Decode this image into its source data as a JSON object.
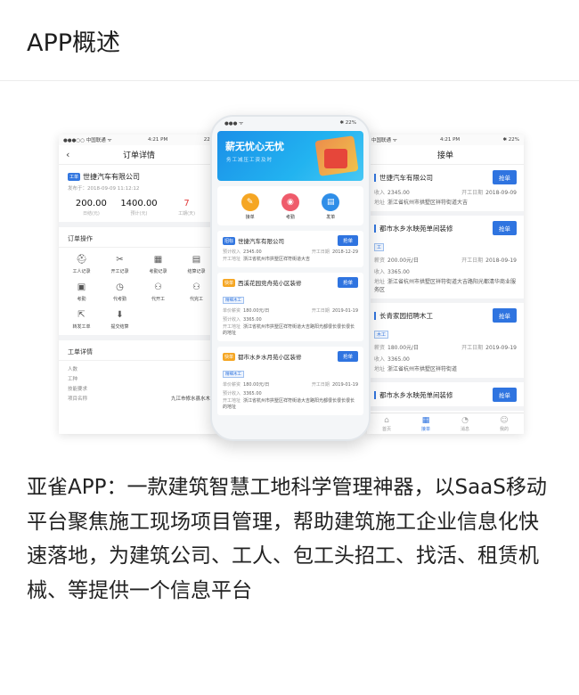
{
  "page_title": "APP概述",
  "description": "亚雀APP：一款建筑智慧工地科学管理神器，以SaaS移动平台聚焦施工现场项目管理，帮助建筑施工企业信息化快速落地，为建筑公司、工人、包工头招工、找活、租赁机械、等提供一个信息平台",
  "left_screen": {
    "status": {
      "carrier": "●●●○○ 中国联通 ᯤ",
      "time": "4:21 PM",
      "battery": "22%"
    },
    "title": "订单详情",
    "back": "‹",
    "order": {
      "tag": "工单",
      "company": "世捷汽车有限公司",
      "published": "发布于：2018-09-09  11:12:12",
      "stats": [
        {
          "num": "200.00",
          "label": "日结(元)"
        },
        {
          "num": "1400.00",
          "label": "预计(元)"
        },
        {
          "num": "7",
          "label": "工期(天)"
        }
      ]
    },
    "ops_title": "订单操作",
    "ops": [
      {
        "icon": "worker-icon",
        "glyph": "⛑",
        "label": "工人记录"
      },
      {
        "icon": "tools-icon",
        "glyph": "✂",
        "label": "开工记录"
      },
      {
        "icon": "calendar-icon",
        "glyph": "▦",
        "label": "考勤记录"
      },
      {
        "icon": "settle-icon",
        "glyph": "▤",
        "label": "结算记录"
      },
      {
        "icon": "checkin-icon",
        "glyph": "▣",
        "label": "考勤"
      },
      {
        "icon": "proxy-checkin-icon",
        "glyph": "◷",
        "label": "代考勤"
      },
      {
        "icon": "proxy-start-icon",
        "glyph": "⚇",
        "label": "代开工"
      },
      {
        "icon": "proxy-icon",
        "glyph": "⚇",
        "label": "代完工"
      },
      {
        "icon": "transfer-icon",
        "glyph": "⇱",
        "label": "转发工单"
      },
      {
        "icon": "submit-icon",
        "glyph": "⬇",
        "label": "提交结算"
      }
    ],
    "detail_title": "工单详情",
    "details": [
      {
        "k": "人数",
        "v": ""
      },
      {
        "k": "工种",
        "v": ""
      },
      {
        "k": "技能要求",
        "v": ""
      },
      {
        "k": "项目名称",
        "v": "九江市修水县水木"
      }
    ]
  },
  "center_phone": {
    "status": {
      "left": "●●●  ᯤ",
      "right": "✱ 22%"
    },
    "banner_title": "薪无忧心无忧",
    "banner_sub": "务工减压工资及时",
    "quick": [
      {
        "icon": "grab-order-icon",
        "glyph": "✎",
        "label": "接单",
        "color": "#f5a623"
      },
      {
        "icon": "attendance-icon",
        "glyph": "◉",
        "label": "考勤",
        "color": "#ef5b6b"
      },
      {
        "icon": "post-order-icon",
        "glyph": "▤",
        "label": "发单",
        "color": "#2f8ee8"
      }
    ],
    "cards": [
      {
        "tag": "招标",
        "tag_color": "blue",
        "title": "世捷汽车有限公司",
        "grab": "抢单",
        "row1_k": "预计收入",
        "row1_v": "2345.00",
        "row1_dk": "开工日期",
        "row1_dv": "2018-12-29",
        "row2_k": "",
        "row2_v": "",
        "addr_k": "开工地址",
        "addr_v": "浙江省杭州市拱墅区祥符街道大吉",
        "subtag": ""
      },
      {
        "tag": "快单",
        "tag_color": "orange",
        "title": "西溪花园竞舟苑小区装修",
        "grab": "抢单",
        "subtag": "精细木工",
        "row1_k": "单价薪资",
        "row1_v": "180.00元/日",
        "row1_dk": "开工日期",
        "row1_dv": "2019-01-19",
        "row2_k": "预计收入",
        "row2_v": "3365.00",
        "addr_k": "开工地址",
        "addr_v": "浙江省杭州市拱墅区祥符街道大吉路阳光都很长很长很长的地址"
      },
      {
        "tag": "快单",
        "tag_color": "orange",
        "title": "都市水乡水月苑小区装修",
        "grab": "抢单",
        "subtag": "精细木工",
        "row1_k": "单价薪资",
        "row1_v": "180.00元/日",
        "row1_dk": "开工日期",
        "row1_dv": "2019-01-19",
        "row2_k": "预计收入",
        "row2_v": "3365.00",
        "addr_k": "开工地址",
        "addr_v": "浙江省杭州市拱墅区祥符街道大吉路阳光都很长很长很长的地址"
      }
    ]
  },
  "right_screen": {
    "status": {
      "carrier": "中国联通 ᯤ",
      "time": "4:21 PM",
      "battery": "✱ 22%"
    },
    "title": "接单",
    "cards": [
      {
        "title": "世捷汽车有限公司",
        "grab": "抢单",
        "subtag": "",
        "row1_k": "收入",
        "row1_v": "2345.00",
        "row1_dk": "开工日期",
        "row1_dv": "2018-09-09",
        "row2_k": "",
        "row2_v": "",
        "addr_k": "地址",
        "addr_v": "浙江省杭州市拱墅区祥符街道大吉"
      },
      {
        "title": "都市水乡水映苑单间装修",
        "grab": "抢单",
        "subtag": "工",
        "row1_k": "薪资",
        "row1_v": "200.00元/日",
        "row1_dk": "开工日期",
        "row1_dv": "2018-09-19",
        "row2_k": "收入",
        "row2_v": "3365.00",
        "addr_k": "地址",
        "addr_v": "浙江省杭州市拱墅区祥符街道大吉路阳光都清华商业服务区"
      },
      {
        "title": "长青家园招聘木工",
        "grab": "抢单",
        "subtag": "木工",
        "row1_k": "薪资",
        "row1_v": "180.00元/日",
        "row1_dk": "开工日期",
        "row1_dv": "2019-09-19",
        "row2_k": "收入",
        "row2_v": "3365.00",
        "addr_k": "地址",
        "addr_v": "浙江省杭州市拱墅区祥符街道"
      },
      {
        "title": "都市水乡水映苑单间装修",
        "grab": "抢单",
        "subtag": "",
        "row1_k": "",
        "row1_v": "",
        "row1_dk": "",
        "row1_dv": "",
        "row2_k": "",
        "row2_v": "",
        "addr_k": "",
        "addr_v": ""
      }
    ],
    "tabs": [
      {
        "icon": "home-icon",
        "glyph": "⌂",
        "label": "首页",
        "active": false
      },
      {
        "icon": "grab-tab-icon",
        "glyph": "▦",
        "label": "接单",
        "active": true
      },
      {
        "icon": "message-icon",
        "glyph": "◔",
        "label": "消息",
        "active": false
      },
      {
        "icon": "profile-icon",
        "glyph": "☺",
        "label": "我的",
        "active": false
      }
    ]
  }
}
